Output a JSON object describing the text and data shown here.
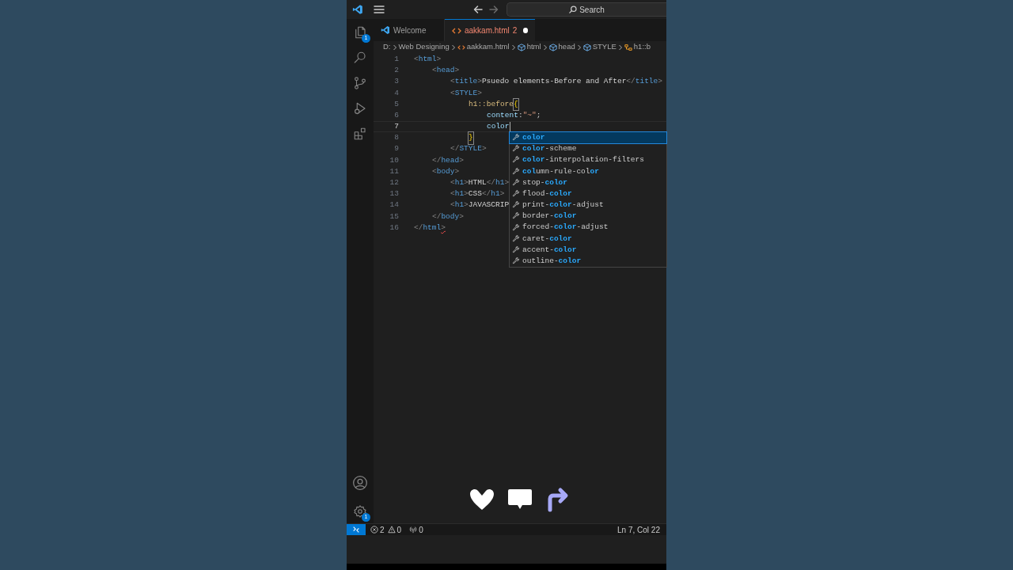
{
  "title_bar": {
    "search": {
      "placeholder": "Search"
    }
  },
  "activity_bar": {
    "top": [
      {
        "kind": "explorer",
        "badge": "1"
      },
      {
        "kind": "search"
      },
      {
        "kind": "source-control"
      },
      {
        "kind": "run-debug"
      },
      {
        "kind": "extensions"
      }
    ],
    "bottom": [
      {
        "kind": "account"
      },
      {
        "kind": "settings",
        "badge": "1"
      }
    ]
  },
  "tabs": [
    {
      "label": "Welcome",
      "kind": "welcome",
      "selected": false
    },
    {
      "label": "aakkam.html",
      "problems": "2",
      "kind": "html",
      "selected": true,
      "dirty": true
    }
  ],
  "breadcrumb": [
    {
      "label": "D:",
      "kind": "folder"
    },
    {
      "label": "Web Designing",
      "kind": "folder"
    },
    {
      "label": "aakkam.html",
      "kind": "file"
    },
    {
      "label": "html",
      "kind": "element"
    },
    {
      "label": "head",
      "kind": "element"
    },
    {
      "label": "STYLE",
      "kind": "element"
    },
    {
      "label": "h1::b",
      "kind": "selector"
    }
  ],
  "editor": {
    "lines": [
      {
        "number": "1",
        "current": false,
        "tokens": [
          {
            "kind": "punct",
            "text": "<"
          },
          {
            "kind": "tag",
            "text": "html"
          },
          {
            "kind": "punct",
            "text": ">"
          }
        ],
        "children": [
          {
            "number": "2",
            "current": false,
            "tokens": [
              {
                "kind": "punct",
                "text": "<"
              },
              {
                "kind": "tag",
                "text": "head"
              },
              {
                "kind": "punct",
                "text": ">"
              }
            ],
            "children": [
              {
                "number": "3",
                "current": false,
                "tokens": [
                  {
                    "kind": "punct",
                    "text": "<"
                  },
                  {
                    "kind": "tag",
                    "text": "title"
                  },
                  {
                    "kind": "punct",
                    "text": ">"
                  },
                  {
                    "kind": "text",
                    "text": "Psuedo elements-Before and After"
                  },
                  {
                    "kind": "punct",
                    "text": "</"
                  },
                  {
                    "kind": "tag",
                    "text": "title"
                  },
                  {
                    "kind": "punct",
                    "text": ">"
                  }
                ]
              },
              {
                "number": "4",
                "current": false,
                "tokens": [
                  {
                    "kind": "punct",
                    "text": "<"
                  },
                  {
                    "kind": "tag",
                    "text": "STYLE"
                  },
                  {
                    "kind": "punct",
                    "text": ">"
                  }
                ],
                "children": [
                  {
                    "number": "5",
                    "current": false,
                    "tokens": [
                      {
                        "kind": "selector",
                        "text": "h1::before"
                      },
                      {
                        "kind": "bracket",
                        "text": "{"
                      }
                    ],
                    "children": [
                      {
                        "number": "6",
                        "current": false,
                        "tokens": [
                          {
                            "kind": "prop",
                            "text": "content"
                          },
                          {
                            "kind": "text",
                            "text": ":"
                          },
                          {
                            "kind": "string",
                            "text": "\"~\""
                          },
                          {
                            "kind": "text",
                            "text": ";"
                          }
                        ]
                      },
                      {
                        "number": "7",
                        "current": true,
                        "tokens": [
                          {
                            "kind": "prop",
                            "text": "color"
                          }
                        ]
                      }
                    ]
                  },
                  {
                    "number": "8",
                    "current": false,
                    "tokens": [
                      {
                        "kind": "bracket",
                        "text": "}"
                      }
                    ]
                  }
                ]
              },
              {
                "number": "9",
                "current": false,
                "tokens": [
                  {
                    "kind": "punct",
                    "text": "</"
                  },
                  {
                    "kind": "tag",
                    "text": "STYLE"
                  },
                  {
                    "kind": "punct",
                    "text": ">"
                  }
                ]
              }
            ]
          },
          {
            "number": "10",
            "current": false,
            "tokens": [
              {
                "kind": "punct",
                "text": "</"
              },
              {
                "kind": "tag",
                "text": "head"
              },
              {
                "kind": "punct",
                "text": ">"
              }
            ]
          },
          {
            "number": "11",
            "current": false,
            "tokens": [
              {
                "kind": "punct",
                "text": "<"
              },
              {
                "kind": "tag",
                "text": "body"
              },
              {
                "kind": "punct",
                "text": ">"
              }
            ],
            "children": [
              {
                "number": "12",
                "current": false,
                "tokens": [
                  {
                    "kind": "punct",
                    "text": "<"
                  },
                  {
                    "kind": "tag",
                    "text": "h1"
                  },
                  {
                    "kind": "punct",
                    "text": ">"
                  },
                  {
                    "kind": "text",
                    "text": "HTML"
                  },
                  {
                    "kind": "punct",
                    "text": "</"
                  },
                  {
                    "kind": "tag",
                    "text": "h1"
                  },
                  {
                    "kind": "punct",
                    "text": ">"
                  }
                ]
              },
              {
                "number": "13",
                "current": false,
                "tokens": [
                  {
                    "kind": "punct",
                    "text": "<"
                  },
                  {
                    "kind": "tag",
                    "text": "h1"
                  },
                  {
                    "kind": "punct",
                    "text": ">"
                  },
                  {
                    "kind": "text",
                    "text": "CSS"
                  },
                  {
                    "kind": "punct",
                    "text": "</"
                  },
                  {
                    "kind": "tag",
                    "text": "h1"
                  },
                  {
                    "kind": "punct",
                    "text": ">"
                  }
                ]
              },
              {
                "number": "14",
                "current": false,
                "tokens": [
                  {
                    "kind": "punct",
                    "text": "<"
                  },
                  {
                    "kind": "tag",
                    "text": "h1"
                  },
                  {
                    "kind": "punct",
                    "text": ">"
                  },
                  {
                    "kind": "text",
                    "text": "JAVASCRIP"
                  }
                ]
              }
            ]
          },
          {
            "number": "15",
            "current": false,
            "tokens": [
              {
                "kind": "punct",
                "text": "</"
              },
              {
                "kind": "tag",
                "text": "body"
              },
              {
                "kind": "punct",
                "text": ">"
              }
            ]
          }
        ]
      },
      {
        "number": "16",
        "current": false,
        "tokens": [
          {
            "kind": "punct",
            "text": "</"
          },
          {
            "kind": "tag",
            "text": "html"
          },
          {
            "kind": "punct",
            "text": ">",
            "error": true
          }
        ]
      }
    ]
  },
  "suggestions": [
    {
      "selected": true,
      "parts": [
        {
          "text": "color",
          "match": true
        }
      ]
    },
    {
      "selected": false,
      "parts": [
        {
          "text": "color",
          "match": true
        },
        {
          "text": "-scheme",
          "match": false
        }
      ]
    },
    {
      "selected": false,
      "parts": [
        {
          "text": "color",
          "match": true
        },
        {
          "text": "-interpolation-filters",
          "match": false
        }
      ]
    },
    {
      "selected": false,
      "parts": [
        {
          "text": "col",
          "match": true
        },
        {
          "text": "umn-rule-col",
          "match": false
        },
        {
          "text": "or",
          "match": true
        }
      ]
    },
    {
      "selected": false,
      "parts": [
        {
          "text": "stop-",
          "match": false
        },
        {
          "text": "color",
          "match": true
        }
      ]
    },
    {
      "selected": false,
      "parts": [
        {
          "text": "flood-",
          "match": false
        },
        {
          "text": "color",
          "match": true
        }
      ]
    },
    {
      "selected": false,
      "parts": [
        {
          "text": "print-",
          "match": false
        },
        {
          "text": "color",
          "match": true
        },
        {
          "text": "-adjust",
          "match": false
        }
      ]
    },
    {
      "selected": false,
      "parts": [
        {
          "text": "border-",
          "match": false
        },
        {
          "text": "color",
          "match": true
        }
      ]
    },
    {
      "selected": false,
      "parts": [
        {
          "text": "forced-",
          "match": false
        },
        {
          "text": "color",
          "match": true
        },
        {
          "text": "-adjust",
          "match": false
        }
      ]
    },
    {
      "selected": false,
      "parts": [
        {
          "text": "caret-",
          "match": false
        },
        {
          "text": "color",
          "match": true
        }
      ]
    },
    {
      "selected": false,
      "parts": [
        {
          "text": "accent-",
          "match": false
        },
        {
          "text": "color",
          "match": true
        }
      ]
    },
    {
      "selected": false,
      "parts": [
        {
          "text": "outline-",
          "match": false
        },
        {
          "text": "color",
          "match": true
        }
      ]
    }
  ],
  "status_bar": {
    "errors": "2",
    "warnings": "0",
    "ports": "0",
    "position": "Ln 7, Col 22"
  },
  "overlay_actions": [
    {
      "kind": "like"
    },
    {
      "kind": "comment"
    },
    {
      "kind": "share"
    }
  ]
}
